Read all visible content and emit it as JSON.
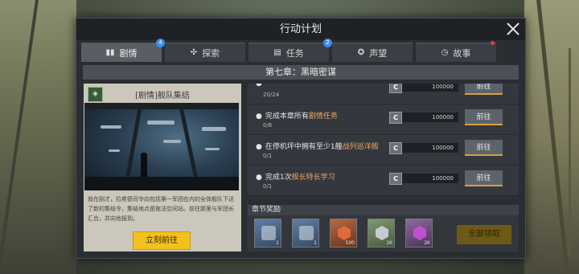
{
  "dialog": {
    "title": "行动计划"
  },
  "tabs": [
    {
      "label": "剧情",
      "icon": "book-icon",
      "badge": "4"
    },
    {
      "label": "探索",
      "icon": "explore-icon",
      "badge": ""
    },
    {
      "label": "任务",
      "icon": "list-icon",
      "badge": "2"
    },
    {
      "label": "声望",
      "icon": "medal-icon",
      "badge": ""
    },
    {
      "label": "故事",
      "icon": "clock-icon",
      "badge": ""
    }
  ],
  "chapter": {
    "title": "第七章：黑暗密谋"
  },
  "story": {
    "title": "[剧情]舰队集结",
    "icon_label": "安全",
    "description": "就在刚才，拉希德司令向包括第一军团在内的全体舰队下达了新的集结令，集结地点是拖法空间站。前往那里与军团长汇合，并向他报到。",
    "go_button": "立刻前往"
  },
  "tasks": [
    {
      "desc_pre": "",
      "desc_hl": "",
      "desc_post": "",
      "progress": "20/24",
      "coin": "C",
      "amount": "100000",
      "button": "前往"
    },
    {
      "desc_pre": "完成本章所有",
      "desc_hl": "剧情任务",
      "desc_post": "",
      "progress": "0/6",
      "coin": "C",
      "amount": "100000",
      "button": "前往"
    },
    {
      "desc_pre": "在停机坪中拥有至少1艘",
      "desc_hl": "战列巡洋舰",
      "desc_post": "",
      "progress": "0/1",
      "coin": "C",
      "amount": "100000",
      "button": "前往"
    },
    {
      "desc_pre": "完成1次",
      "desc_hl": "舰长特长学习",
      "desc_post": "",
      "progress": "0/1",
      "coin": "C",
      "amount": "100000",
      "button": "前往"
    }
  ],
  "rewards": {
    "title": "章节奖励",
    "items": [
      {
        "icon": "turret-blueprint-icon",
        "count": "1"
      },
      {
        "icon": "turret-blueprint-icon",
        "count": "1"
      },
      {
        "icon": "red-crystal-icon",
        "count": "500"
      },
      {
        "icon": "silver-crystal-icon",
        "count": "1K"
      },
      {
        "icon": "purple-crystal-icon",
        "count": "2K"
      }
    ],
    "claim_all": "全部领取"
  }
}
